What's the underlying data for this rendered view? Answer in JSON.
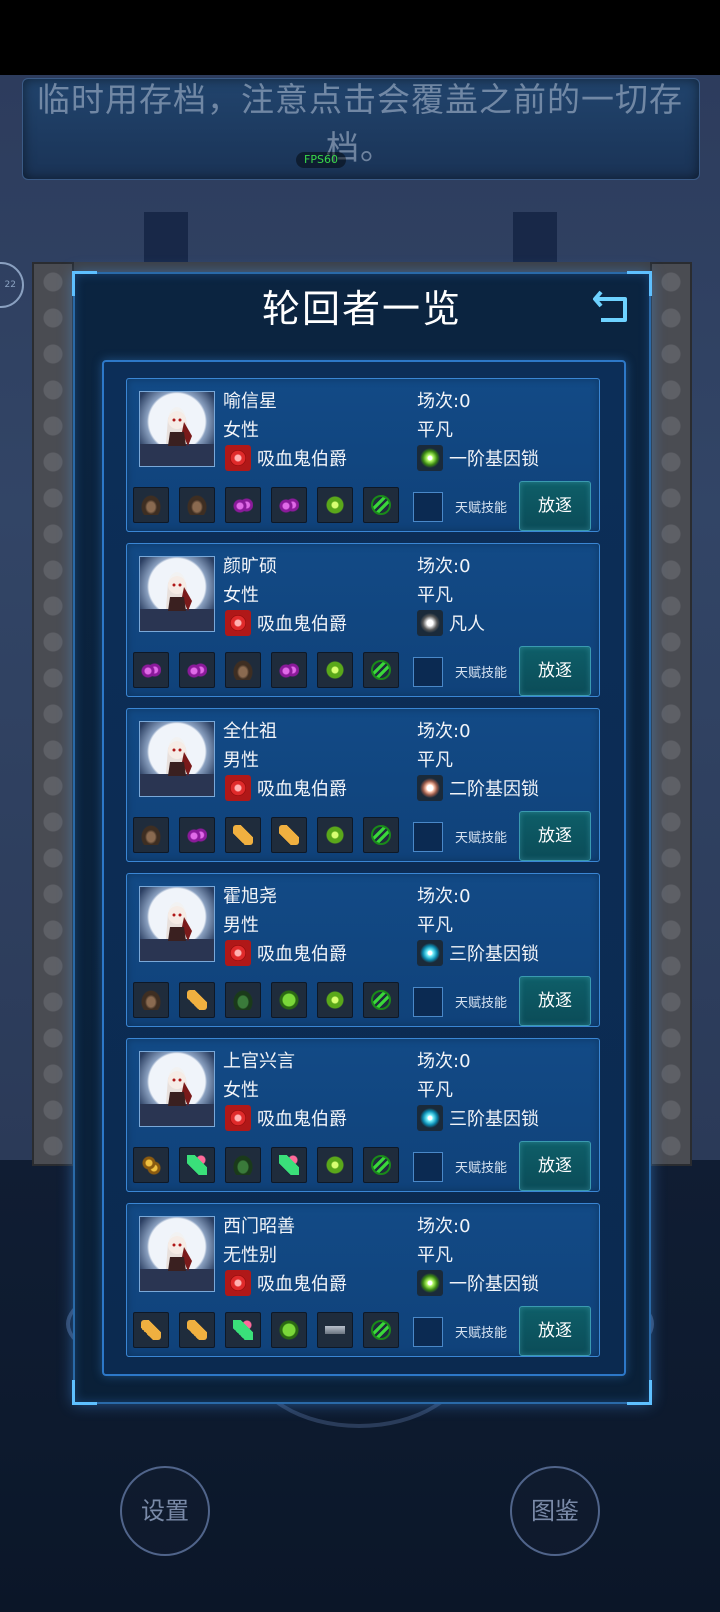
{
  "notice": {
    "text": "临时用存档，注意点击会覆盖之前的一切存档。"
  },
  "fps": "FPS60",
  "side_badge": "22",
  "dialog": {
    "title": "轮回者一览",
    "checkbox_label": "天赋技能",
    "exile_label": "放逐"
  },
  "characters": [
    {
      "name": "喻信星",
      "gender": "女性",
      "race": "吸血鬼伯爵",
      "scene": "场次:0",
      "rank": "平凡",
      "gene": "一阶基因锁",
      "items": [
        "dark-ore",
        "dark-ore",
        "purple-crystal",
        "purple-crystal",
        "green-scope",
        "dna-helix"
      ]
    },
    {
      "name": "颜旷硕",
      "gender": "女性",
      "race": "吸血鬼伯爵",
      "scene": "场次:0",
      "rank": "平凡",
      "gene": "凡人",
      "items": [
        "purple-crystal",
        "purple-crystal",
        "dark-ore",
        "purple-crystal",
        "green-scope",
        "dna-helix"
      ]
    },
    {
      "name": "全仕祖",
      "gender": "男性",
      "race": "吸血鬼伯爵",
      "scene": "场次:0",
      "rank": "平凡",
      "gene": "二阶基因锁",
      "items": [
        "dark-ore",
        "purple-crystal",
        "yellow-potion",
        "yellow-potion",
        "green-scope",
        "dna-helix"
      ]
    },
    {
      "name": "霍旭尧",
      "gender": "男性",
      "race": "吸血鬼伯爵",
      "scene": "场次:0",
      "rank": "平凡",
      "gene": "三阶基因锁",
      "items": [
        "dark-ore",
        "yellow-potion",
        "dark-green-ore",
        "green-ore",
        "green-scope",
        "dna-helix"
      ]
    },
    {
      "name": "上官兴言",
      "gender": "女性",
      "race": "吸血鬼伯爵",
      "scene": "场次:0",
      "rank": "平凡",
      "gene": "三阶基因锁",
      "items": [
        "gold-ore",
        "green-potion",
        "dark-green-ore",
        "green-potion",
        "green-scope",
        "dna-helix"
      ]
    },
    {
      "name": "西门昭善",
      "gender": "无性别",
      "race": "吸血鬼伯爵",
      "scene": "场次:0",
      "rank": "平凡",
      "gene": "一阶基因锁",
      "items": [
        "yellow-potion",
        "yellow-potion",
        "green-potion",
        "green-ore",
        "gun",
        "dna-helix"
      ]
    }
  ],
  "bottom_buttons": {
    "settings": "设置",
    "codex": "图鉴"
  }
}
